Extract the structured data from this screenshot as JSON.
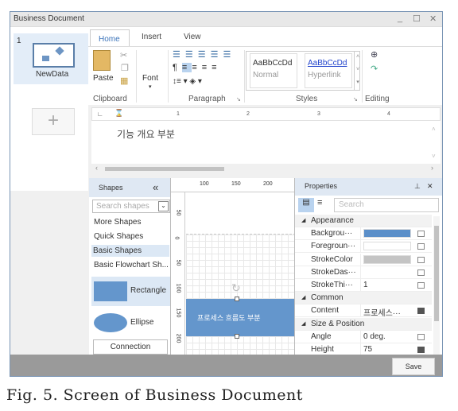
{
  "window": {
    "title": "Business Document",
    "minimize": "_",
    "maximize": "☐",
    "close": "✕"
  },
  "pages": {
    "index": "1",
    "name": "NewData",
    "add": "+"
  },
  "ribbon": {
    "tabs": [
      "Home",
      "Insert",
      "View"
    ],
    "clipboard": {
      "paste": "Paste",
      "label": "Clipboard"
    },
    "font": {
      "label": "Font"
    },
    "paragraph": {
      "label": "Paragraph"
    },
    "styles": {
      "label": "Styles",
      "items": [
        {
          "sample": "AaBbCcDd",
          "name": "Normal"
        },
        {
          "sample": "AaBbCcDd",
          "name": "Hyperlink"
        }
      ]
    },
    "editing": {
      "label": "Editing"
    }
  },
  "ruler": {
    "ticks": [
      "1",
      "2",
      "3",
      "4"
    ]
  },
  "document": {
    "text": "기능 개요 부분"
  },
  "shapes": {
    "title": "Shapes",
    "collapse": "«",
    "search_placeholder": "Search shapes",
    "categories": [
      "More Shapes",
      "Quick Shapes",
      "Basic Shapes",
      "Basic Flowchart Sh..."
    ],
    "selected": "Basic Shapes",
    "items": [
      "Rectangle",
      "Ellipse"
    ],
    "connection": "Connection"
  },
  "canvas": {
    "hruler": [
      "100",
      "150",
      "200"
    ],
    "vruler": [
      "50",
      "0",
      "50",
      "100",
      "150",
      "200"
    ],
    "shape_text": "프로세스 흐름도 부분"
  },
  "properties": {
    "title": "Properties",
    "pin": "⊥",
    "close": "✕",
    "search_placeholder": "Search",
    "rows": [
      {
        "type": "cat",
        "name": "Appearance"
      },
      {
        "name": "Backgrou···",
        "swatch": "#5b8fc9"
      },
      {
        "name": "Foregroun···",
        "swatch": "#ffffff"
      },
      {
        "name": "StrokeColor",
        "swatch": "#c4c4c4"
      },
      {
        "name": "StrokeDas···",
        "value": ""
      },
      {
        "name": "StrokeThi···",
        "value": "1"
      },
      {
        "type": "cat",
        "name": "Common"
      },
      {
        "name": "Content",
        "value": "프로세스···",
        "filled": true
      },
      {
        "type": "cat",
        "name": "Size & Position"
      },
      {
        "name": "Angle",
        "value": "0 deg."
      },
      {
        "name": "Height",
        "value": "75",
        "filled": true
      }
    ]
  },
  "footer": {
    "save": "Save"
  },
  "caption": "Fig. 5. Screen of Business Document",
  "colors": {
    "accent": "#3b73b9",
    "shape_fill": "#6496cc",
    "selected_bg": "#dce8f5"
  }
}
